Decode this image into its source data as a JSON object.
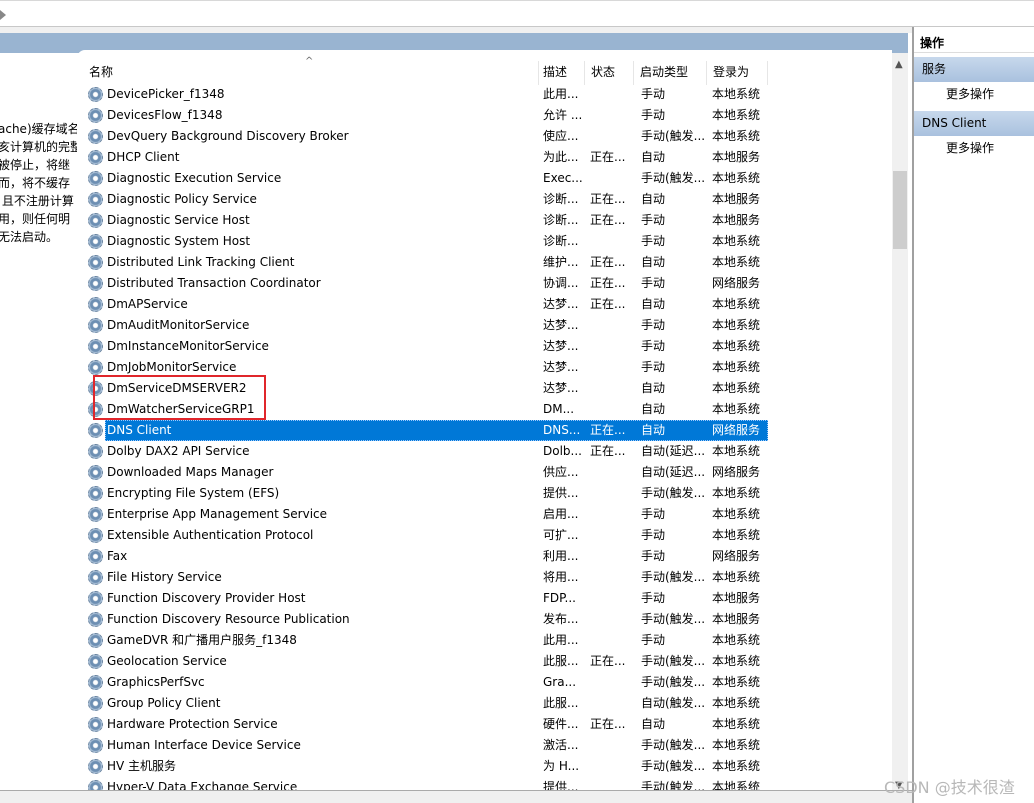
{
  "description_fragment": "ache)缓存域名\n亥计算机的完整\n被停止，将继\n而，将不缓存\n 且不注册计算\n用，则任何明\n无法启动。",
  "columns": [
    "名称",
    "描述",
    "状态",
    "启动类型",
    "登录为"
  ],
  "selected_index": 16,
  "highlight_color": "#0078d7",
  "rows": [
    [
      "DevicePicker_f1348",
      "此用...",
      "",
      "手动",
      "本地系统"
    ],
    [
      "DevicesFlow_f1348",
      "允许 ...",
      "",
      "手动",
      "本地系统"
    ],
    [
      "DevQuery Background Discovery Broker",
      "使应...",
      "",
      "手动(触发...",
      "本地系统"
    ],
    [
      "DHCP Client",
      "为此...",
      "正在...",
      "自动",
      "本地服务"
    ],
    [
      "Diagnostic Execution Service",
      "Exec...",
      "",
      "手动(触发...",
      "本地系统"
    ],
    [
      "Diagnostic Policy Service",
      "诊断...",
      "正在...",
      "自动",
      "本地服务"
    ],
    [
      "Diagnostic Service Host",
      "诊断...",
      "正在...",
      "手动",
      "本地服务"
    ],
    [
      "Diagnostic System Host",
      "诊断...",
      "",
      "手动",
      "本地系统"
    ],
    [
      "Distributed Link Tracking Client",
      "维护...",
      "正在...",
      "自动",
      "本地系统"
    ],
    [
      "Distributed Transaction Coordinator",
      "协调...",
      "正在...",
      "手动",
      "网络服务"
    ],
    [
      "DmAPService",
      "达梦...",
      "正在...",
      "自动",
      "本地系统"
    ],
    [
      "DmAuditMonitorService",
      "达梦...",
      "",
      "手动",
      "本地系统"
    ],
    [
      "DmInstanceMonitorService",
      "达梦...",
      "",
      "手动",
      "本地系统"
    ],
    [
      "DmJobMonitorService",
      "达梦...",
      "",
      "手动",
      "本地系统"
    ],
    [
      "DmServiceDMSERVER2",
      "达梦...",
      "",
      "自动",
      "本地系统"
    ],
    [
      "DmWatcherServiceGRP1",
      "DM...",
      "",
      "自动",
      "本地系统"
    ],
    [
      "DNS Client",
      "DNS...",
      "正在...",
      "自动",
      "网络服务"
    ],
    [
      "Dolby DAX2 API Service",
      "Dolb...",
      "正在...",
      "自动(延迟...",
      "本地系统"
    ],
    [
      "Downloaded Maps Manager",
      "供应...",
      "",
      "自动(延迟...",
      "网络服务"
    ],
    [
      "Encrypting File System (EFS)",
      "提供...",
      "",
      "手动(触发...",
      "本地系统"
    ],
    [
      "Enterprise App Management Service",
      "启用...",
      "",
      "手动",
      "本地系统"
    ],
    [
      "Extensible Authentication Protocol",
      "可扩...",
      "",
      "手动",
      "本地系统"
    ],
    [
      "Fax",
      "利用...",
      "",
      "手动",
      "网络服务"
    ],
    [
      "File History Service",
      "将用...",
      "",
      "手动(触发...",
      "本地系统"
    ],
    [
      "Function Discovery Provider Host",
      "FDP...",
      "",
      "手动",
      "本地服务"
    ],
    [
      "Function Discovery Resource Publication",
      "发布...",
      "",
      "手动(触发...",
      "本地服务"
    ],
    [
      "GameDVR 和广播用户服务_f1348",
      "此用...",
      "",
      "手动",
      "本地系统"
    ],
    [
      "Geolocation Service",
      "此服...",
      "正在...",
      "手动(触发...",
      "本地系统"
    ],
    [
      "GraphicsPerfSvc",
      "Gra...",
      "",
      "手动(触发...",
      "本地系统"
    ],
    [
      "Group Policy Client",
      "此服...",
      "",
      "自动(触发...",
      "本地系统"
    ],
    [
      "Hardware Protection Service",
      "硬件...",
      "正在...",
      "自动",
      "本地系统"
    ],
    [
      "Human Interface Device Service",
      "激活...",
      "",
      "手动(触发...",
      "本地系统"
    ],
    [
      "HV 主机服务",
      "为 H...",
      "",
      "手动(触发...",
      "本地系统"
    ],
    [
      "Hyper-V Data Exchange Service",
      "提供...",
      "",
      "手动(触发...",
      "本地系统"
    ]
  ],
  "actions": {
    "title": "操作",
    "section1": "服务",
    "more1": "更多操作",
    "section2": "DNS Client",
    "more2": "更多操作"
  },
  "watermark": "CSDN @技术很渣"
}
